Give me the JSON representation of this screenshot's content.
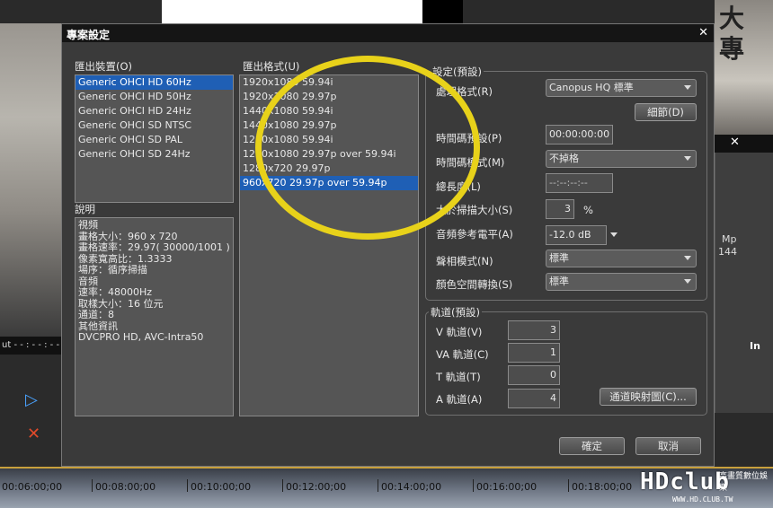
{
  "background": {
    "left_strip": "ut  - - : - - : - -",
    "right_strip": "In",
    "right_mp": "Mp",
    "right_144": "144",
    "sign": "大\n專",
    "timeline": [
      "00:06:00;00",
      "00:08:00;00",
      "00:10:00;00",
      "00:12:00;00",
      "00:14:00;00",
      "00:16:00;00",
      "00:18:00;00"
    ],
    "logo": "HDclub",
    "logo_sub": "WWW.HD.CLUB.TW",
    "logo_zh": "高畫質數位娛樂"
  },
  "dialog": {
    "title": "專案設定",
    "export_device_label": "匯出裝置(O)",
    "devices": [
      "Generic OHCI HD 60Hz",
      "Generic OHCI HD 50Hz",
      "Generic OHCI HD 24Hz",
      "Generic OHCI SD NTSC",
      "Generic OHCI SD PAL",
      "Generic OHCI SD 24Hz"
    ],
    "export_format_label": "匯出格式(U)",
    "formats": [
      "1920x1080 59.94i",
      "1920x1080 29.97p",
      "1440x1080 59.94i",
      "1440x1080 29.97p",
      "1280x1080 59.94i",
      "1280x1080 29.97p over 59.94i",
      "1280x720 29.97p",
      "960x720 29.97p over 59.94p"
    ],
    "selected_format": 7,
    "description_label": "說明",
    "description": [
      "視頻",
      "畫格大小：960 x 720",
      "畫格速率：29.97( 30000/1001 )",
      "像素寬高比：1.3333",
      "場序：循序掃描",
      "音頻",
      "速率：48000Hz",
      "取樣大小：16 位元",
      "通道：8",
      "其他資訊",
      "DVCPRO HD, AVC-Intra50"
    ],
    "settings": {
      "group_title": "設定(預設)",
      "render_format_label": "處理格式(R)",
      "render_format_value": "Canopus HQ 標準",
      "detail_button": "細節(D)",
      "timecode_preset_label": "時間碼預設(P)",
      "timecode_preset_value": "00:00:00:00",
      "timecode_mode_label": "時間碼模式(M)",
      "timecode_mode_value": "不掉格",
      "total_length_label": "總長度(L)",
      "total_length_value": "--:--:--:--",
      "overscan_label": "大於掃描大小(S)",
      "overscan_value": "3",
      "overscan_unit": "%",
      "audio_ref_label": "音頻參考電平(A)",
      "audio_ref_value": "-12.0 dB",
      "phase_mode_label": "聲相模式(N)",
      "phase_mode_value": "標準",
      "color_space_label": "顏色空間轉換(S)",
      "color_space_value": "標準"
    },
    "tracks": {
      "group_title": "軌道(預設)",
      "v_label": "V 軌道(V)",
      "v_value": "3",
      "va_label": "VA 軌道(C)",
      "va_value": "1",
      "t_label": "T 軌道(T)",
      "t_value": "0",
      "a_label": "A 軌道(A)",
      "a_value": "4",
      "channel_map_button": "通道映射圖(C)..."
    },
    "ok_button": "確定",
    "cancel_button": "取消"
  },
  "colors": {
    "highlight": "#1f5fb5",
    "annotation_circle": "#e8d21a"
  }
}
